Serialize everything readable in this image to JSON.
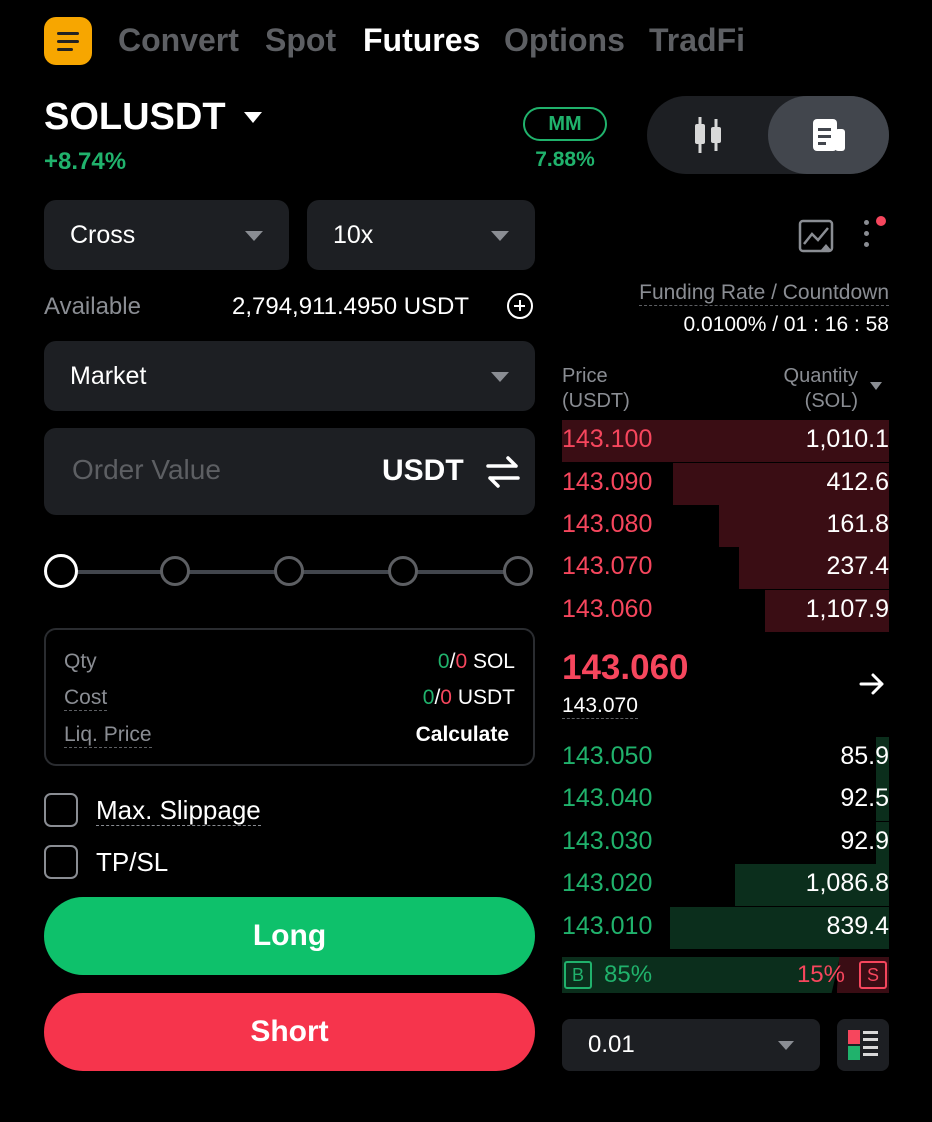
{
  "nav": {
    "tabs": [
      {
        "label": "Convert",
        "active": false
      },
      {
        "label": "Spot",
        "active": false
      },
      {
        "label": "Futures",
        "active": true
      },
      {
        "label": "Options",
        "active": false
      },
      {
        "label": "TradFi",
        "active": false
      }
    ]
  },
  "symbol": {
    "name": "SOLUSDT",
    "change": "+8.74%",
    "mm_label": "MM",
    "mm_value": "7.88%"
  },
  "form": {
    "margin_mode": "Cross",
    "leverage": "10x",
    "available_label": "Available",
    "available_value": "2,794,911.4950 USDT",
    "order_type": "Market",
    "order_value_placeholder": "Order Value",
    "order_unit": "USDT",
    "info": {
      "qty_label": "Qty",
      "qty_buy": "0",
      "qty_sep": "/",
      "qty_sell": "0",
      "qty_unit": "SOL",
      "cost_label": "Cost",
      "cost_buy": "0",
      "cost_sep": "/",
      "cost_sell": "0",
      "cost_unit": "USDT",
      "liq_label": "Liq. Price",
      "liq_value": "Calculate"
    },
    "max_slippage_label": "Max. Slippage",
    "tpsl_label": "TP/SL",
    "long_label": "Long",
    "short_label": "Short"
  },
  "funding": {
    "label": "Funding Rate / Countdown",
    "value": "0.0100% / 01 : 16 : 58"
  },
  "orderbook": {
    "price_header": "Price",
    "price_unit": "(USDT)",
    "qty_header": "Quantity",
    "qty_unit": "(SOL)",
    "asks": [
      {
        "price": "143.100",
        "qty": "1,010.1",
        "depth": 1.0
      },
      {
        "price": "143.090",
        "qty": "412.6",
        "depth": 0.66
      },
      {
        "price": "143.080",
        "qty": "161.8",
        "depth": 0.52
      },
      {
        "price": "143.070",
        "qty": "237.4",
        "depth": 0.46
      },
      {
        "price": "143.060",
        "qty": "1,107.9",
        "depth": 0.38
      }
    ],
    "last_price": "143.060",
    "mark_price": "143.070",
    "bids": [
      {
        "price": "143.050",
        "qty": "85.9",
        "depth": 0.04
      },
      {
        "price": "143.040",
        "qty": "92.5",
        "depth": 0.04
      },
      {
        "price": "143.030",
        "qty": "92.9",
        "depth": 0.04
      },
      {
        "price": "143.020",
        "qty": "1,086.8",
        "depth": 0.47
      },
      {
        "price": "143.010",
        "qty": "839.4",
        "depth": 0.67
      }
    ],
    "buy_badge": "B",
    "buy_ratio": "85%",
    "sell_ratio": "15%",
    "sell_badge": "S",
    "buy_fraction": 0.85,
    "precision": "0.01"
  },
  "colors": {
    "accent": "#f7a600",
    "green": "#20b26c",
    "red": "#f6465d"
  }
}
